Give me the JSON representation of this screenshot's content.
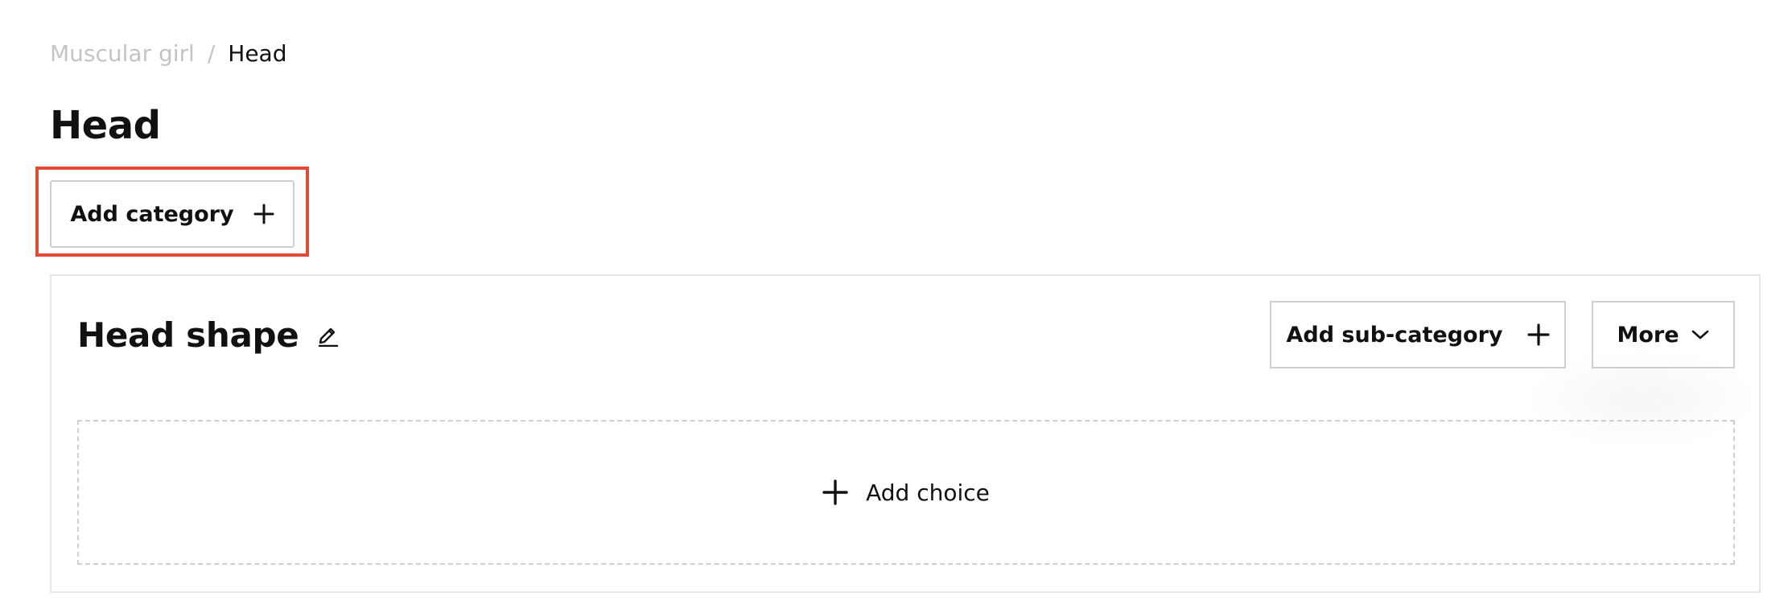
{
  "breadcrumb": {
    "parent": "Muscular girl",
    "separator": "/",
    "current": "Head"
  },
  "page": {
    "title": "Head"
  },
  "toolbar": {
    "add_category_label": "Add category"
  },
  "category": {
    "title": "Head shape",
    "add_subcategory_label": "Add sub-category",
    "more_label": "More",
    "add_choice_label": "Add choice"
  },
  "icons": {
    "add": "plus-icon",
    "edit": "pencil-icon",
    "dropdown": "chevron-down-icon"
  },
  "colors": {
    "text": "#111111",
    "breadcrumb_muted": "#c4c4c4",
    "border": "#cfcfcf",
    "highlight": "#e24a33"
  }
}
